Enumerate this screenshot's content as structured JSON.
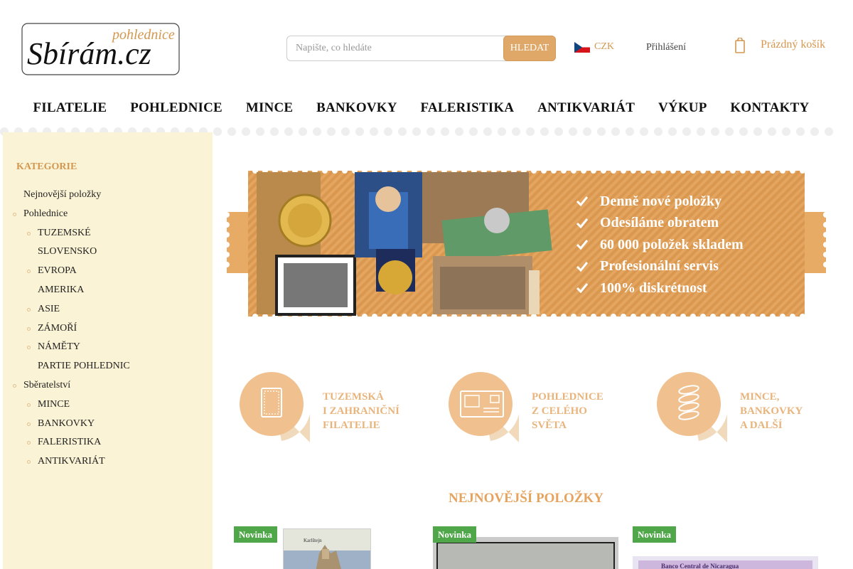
{
  "header": {
    "logo_main": "Sbírám.cz",
    "logo_sub": "pohlednice",
    "search_placeholder": "Napište, co hledáte",
    "search_button": "HLEDAT",
    "currency": "CZK",
    "login": "Přihlášení",
    "cart": "Prázdný košík"
  },
  "nav": [
    "FILATELIE",
    "POHLEDNICE",
    "MINCE",
    "BANKOVKY",
    "FALERISTIKA",
    "ANTIKVARIÁT",
    "VÝKUP",
    "KONTAKTY"
  ],
  "sidebar": {
    "title": "KATEGORIE",
    "items": [
      {
        "label": "Nejnovější položky",
        "level": 0,
        "bullet": false
      },
      {
        "label": "Pohlednice",
        "level": 0,
        "bullet": true
      },
      {
        "label": "TUZEMSKÉ",
        "level": 1,
        "bullet": true
      },
      {
        "label": "SLOVENSKO",
        "level": 1,
        "bullet": false
      },
      {
        "label": "EVROPA",
        "level": 1,
        "bullet": true
      },
      {
        "label": "AMERIKA",
        "level": 1,
        "bullet": false
      },
      {
        "label": "ASIE",
        "level": 1,
        "bullet": true
      },
      {
        "label": "ZÁMOŘÍ",
        "level": 1,
        "bullet": true
      },
      {
        "label": "NÁMĚTY",
        "level": 1,
        "bullet": true
      },
      {
        "label": "PARTIE POHLEDNIC",
        "level": 1,
        "bullet": false
      },
      {
        "label": "Sběratelství",
        "level": 0,
        "bullet": true
      },
      {
        "label": "MINCE",
        "level": 1,
        "bullet": true
      },
      {
        "label": "BANKOVKY",
        "level": 1,
        "bullet": true
      },
      {
        "label": "FALERISTIKA",
        "level": 1,
        "bullet": true
      },
      {
        "label": "ANTIKVARIÁT",
        "level": 1,
        "bullet": true
      }
    ]
  },
  "banner": {
    "lines": [
      "Denně nové položky",
      "Odesíláme obratem",
      "60 000 položek skladem",
      "Profesionální servis",
      "100% diskrétnost"
    ]
  },
  "categories": [
    {
      "label": "TUZEMSKÁ\nI ZAHRANIČNÍ\nFILATELIE",
      "icon": "stamp-icon"
    },
    {
      "label": "POHLEDNICE\nZ CELÉHO\nSVĚTA",
      "icon": "postcard-icon"
    },
    {
      "label": "MINCE,\nBANKOVKY\nA DALŠÍ",
      "icon": "coins-icon"
    }
  ],
  "newest": {
    "title": "NEJNOVĚJŠÍ POLOŽKY",
    "products": [
      {
        "badge": "Novinka",
        "caption": "Karlštejn"
      },
      {
        "badge": "Novinka"
      },
      {
        "badge": "Novinka",
        "caption": "Banco Central de Nicaragua"
      }
    ]
  },
  "colors": {
    "accent": "#d5974f",
    "button": "#e0a868",
    "sidebar_bg": "#fbf3d5",
    "badge": "#4fa74a",
    "banner": "#e0a35c"
  }
}
